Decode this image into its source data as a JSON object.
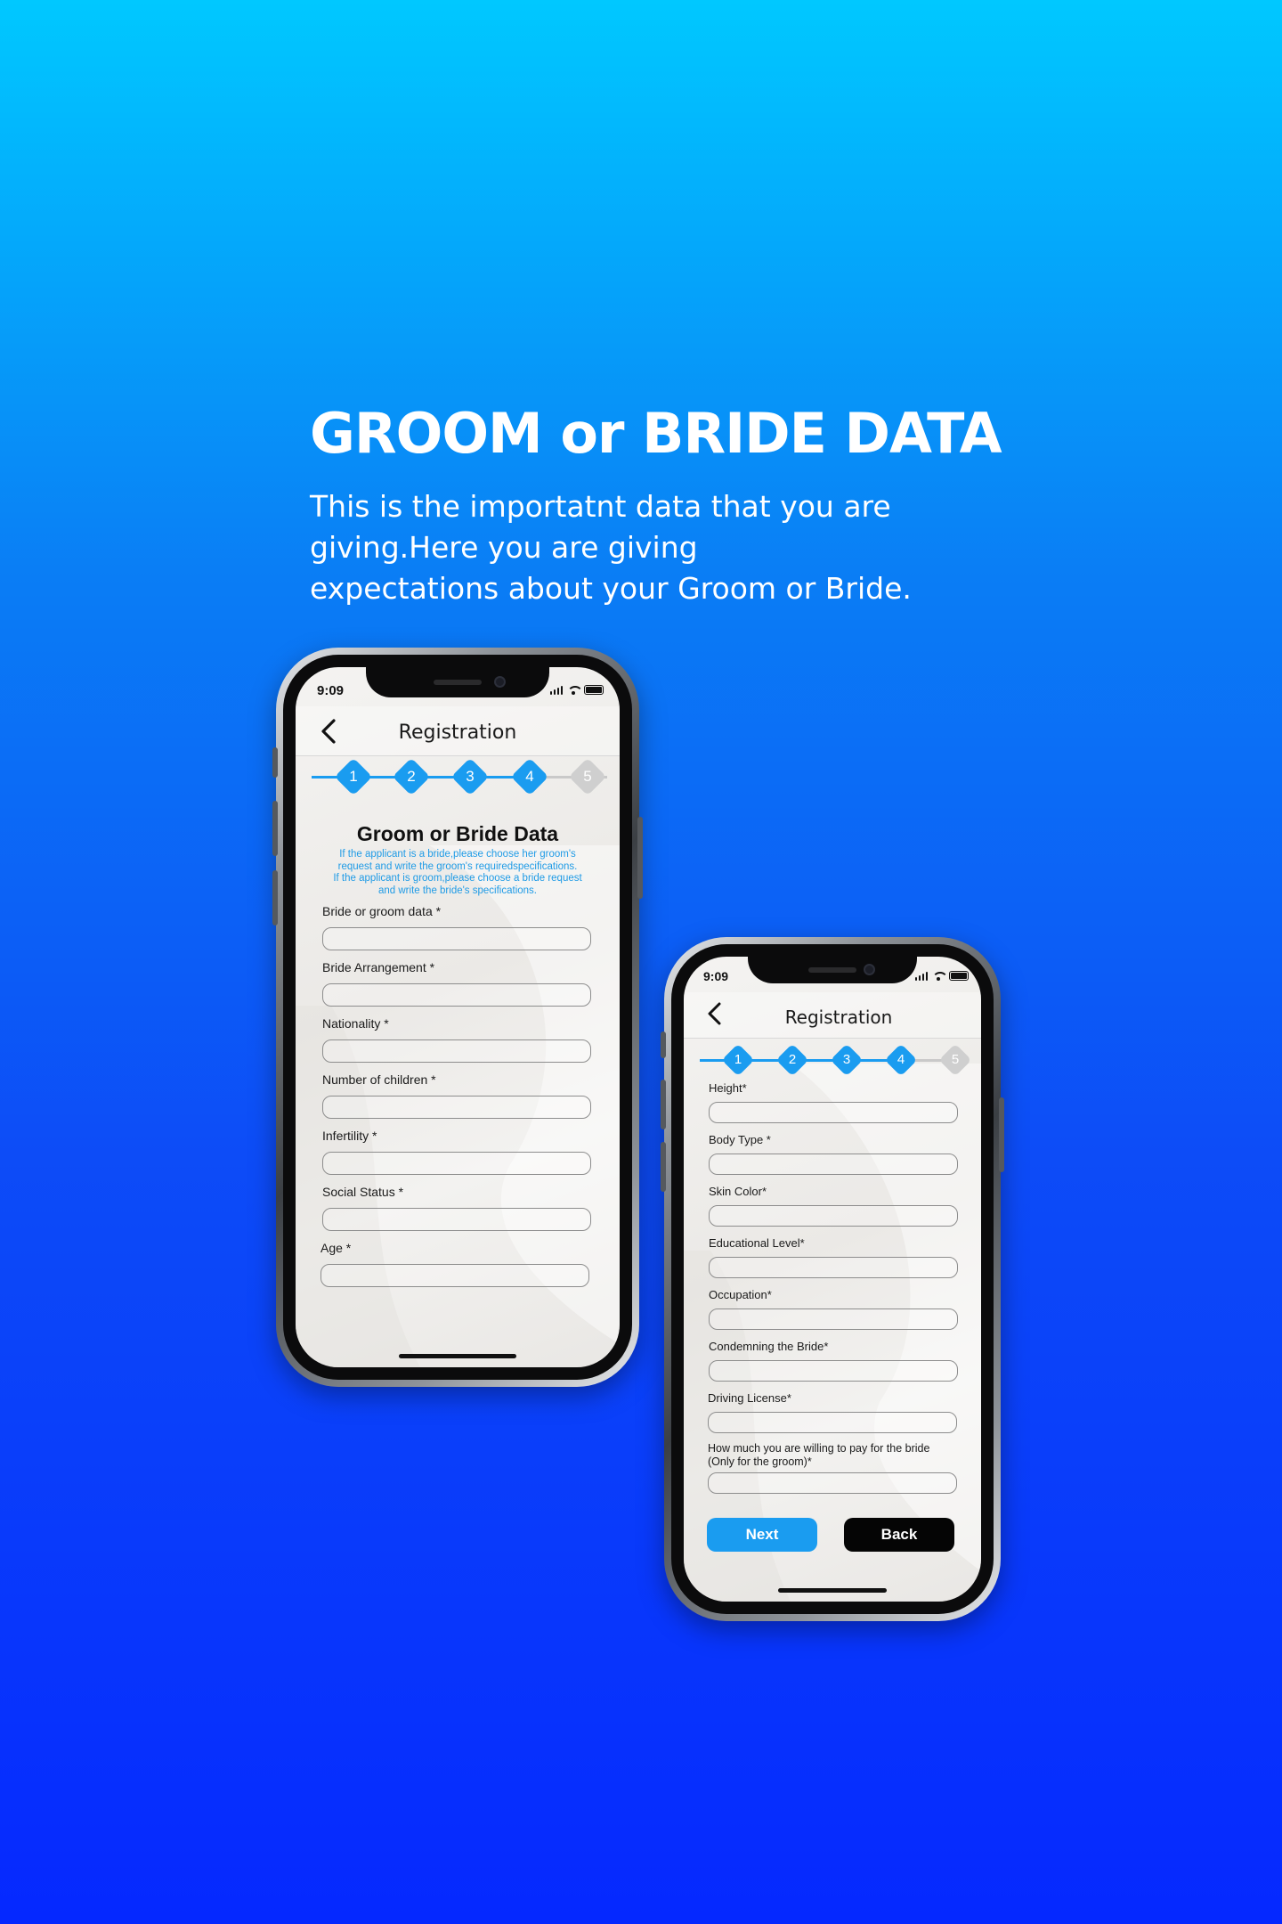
{
  "hero": {
    "title": "GROOM or BRIDE DATA",
    "description_lines": [
      "This is the importatnt data that you are",
      "giving.Here you are giving",
      "expectations about your Groom or Bride."
    ]
  },
  "phone_left": {
    "status_time": "9:09",
    "nav_title": "Registration",
    "steps": [
      {
        "label": "1",
        "state": "done"
      },
      {
        "label": "2",
        "state": "done"
      },
      {
        "label": "3",
        "state": "done"
      },
      {
        "label": "4",
        "state": "done"
      },
      {
        "label": "5",
        "state": "todo"
      }
    ],
    "form_title": "Groom or Bride Data",
    "form_note_lines": [
      "If the applicant is a bride,please choose her groom's",
      "request and write the groom's requiredspecifications.",
      "If the applicant is groom,please choose a bride request",
      "and write the bride's specifications."
    ],
    "fields": [
      {
        "label": "Bride or groom data *"
      },
      {
        "label": "Bride Arrangement *"
      },
      {
        "label": "Nationality *"
      },
      {
        "label": "Number of children *"
      },
      {
        "label": "Infertility *"
      },
      {
        "label": "Social Status *"
      },
      {
        "label": "Age *"
      }
    ]
  },
  "phone_right": {
    "status_time": "9:09",
    "nav_title": "Registration",
    "steps": [
      {
        "label": "1",
        "state": "done"
      },
      {
        "label": "2",
        "state": "done"
      },
      {
        "label": "3",
        "state": "done"
      },
      {
        "label": "4",
        "state": "done"
      },
      {
        "label": "5",
        "state": "todo"
      }
    ],
    "fields": [
      {
        "label": "Height*"
      },
      {
        "label": "Body Type *"
      },
      {
        "label": "Skin Color*"
      },
      {
        "label": "Educational Level*"
      },
      {
        "label": "Occupation*"
      },
      {
        "label": "Condemning the Bride*"
      },
      {
        "label": "Driving License*"
      },
      {
        "label": "How much you are willing to pay for the bride",
        "label2": "(Only for the groom)*"
      }
    ],
    "next_label": "Next",
    "back_label": "Back"
  },
  "colors": {
    "accent": "#1a9cf0",
    "step_inactive": "#cfcfcf",
    "back_button": "#000000",
    "gradient_top": "#00c8ff",
    "gradient_bottom": "#0528ff"
  },
  "icons": {
    "back": "chevron-left-icon",
    "signal": "signal-icon",
    "wifi": "wifi-icon",
    "battery": "battery-icon"
  }
}
